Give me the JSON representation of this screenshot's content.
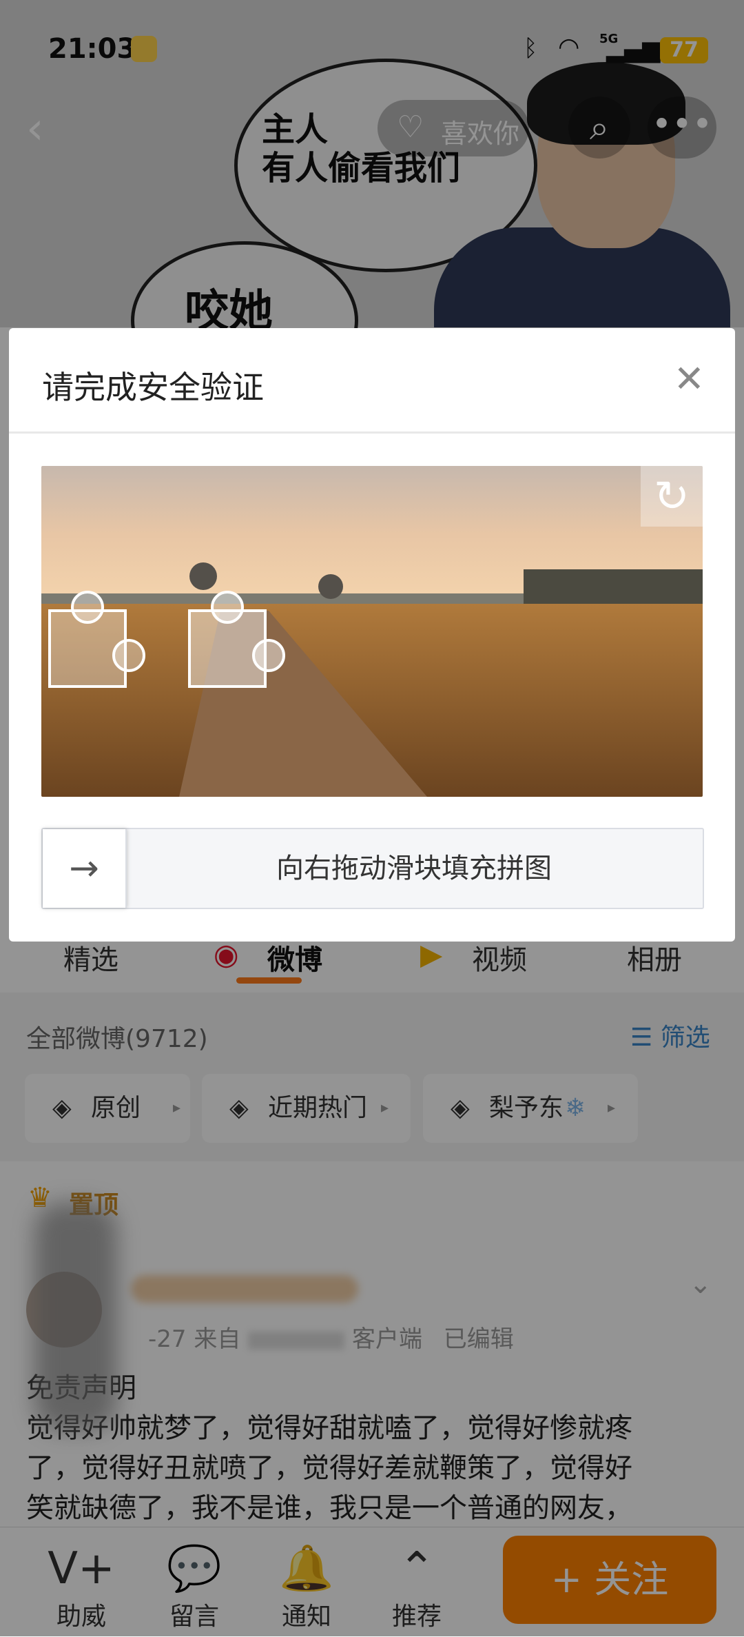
{
  "status_bar": {
    "time": "21:03",
    "battery": "77",
    "network": "5G",
    "icons": [
      "bluetooth-icon",
      "wifi-icon",
      "signal-icon"
    ]
  },
  "header": {
    "like_button": "喜欢你",
    "bubble_1": "主人\n有人偷看我们",
    "bubble_2": "咬她"
  },
  "modal": {
    "title": "请完成安全验证",
    "slider_hint": "向右拖动滑块填充拼图"
  },
  "tabs": [
    "精选",
    "微博",
    "视频",
    "相册"
  ],
  "filter": {
    "all_weibo": "全部微博(9712)",
    "filter_label": "筛选",
    "chips": [
      "原创",
      "近期热门",
      "梨予东"
    ]
  },
  "post": {
    "pinned": "置顶",
    "meta_date": "-27",
    "meta_source_prefix": "来自",
    "meta_source_suffix": "客户端",
    "meta_edited": "已编辑",
    "body_line1": "免责声明",
    "body_line2": "觉得好帅就梦了，觉得好甜就嗑了，觉得好惨就疼",
    "body_line3": "了，觉得好丑就喷了，觉得好差就鞭策了，觉得好",
    "body_line4": "笑就缺德了，我不是谁，我只是一个普通的网友，"
  },
  "bottom_nav": {
    "items": [
      "助威",
      "留言",
      "通知",
      "推荐"
    ],
    "follow": "+ 关注"
  },
  "colors": {
    "accent": "#ff8200",
    "battery": "#ffc107"
  }
}
